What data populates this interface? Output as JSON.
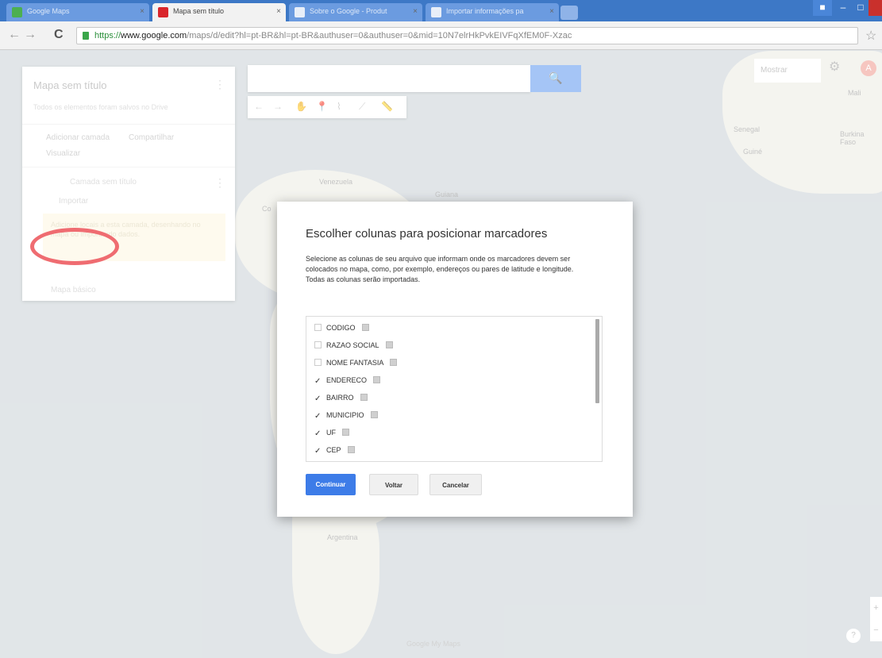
{
  "browser": {
    "tabs": [
      {
        "label": "Google Maps",
        "active": false
      },
      {
        "label": "Mapa sem título",
        "active": true
      },
      {
        "label": "Sobre o Google - Produt",
        "active": false
      },
      {
        "label": "Importar informações pa",
        "active": false
      }
    ],
    "close_glyph": "×",
    "url_scheme": "https://",
    "url_host": "www.google.com",
    "url_path": "/maps/d/edit?hl=pt-BR&hl=pt-BR&authuser=0&authuser=0&mid=10N7elrHkPvkEIVFqXfEM0F-Xzac",
    "back_glyph": "←",
    "forward_glyph": "→",
    "reload_glyph": "C",
    "star_glyph": "☆",
    "minimize_glyph": "–",
    "maximize_glyph": "□"
  },
  "left_panel": {
    "title": "Mapa sem título",
    "description": "Todos os elementos foram salvos no Drive",
    "add_layer": "Adicionar camada",
    "share": "Compartilhar",
    "preview": "Visualizar",
    "layer_name": "Camada sem título",
    "import": "Importar",
    "note": "Adicione locais a esta camada, desenhando no mapa ou importando dados.",
    "base_map": "Mapa básico",
    "menu_glyph": "⋮"
  },
  "map": {
    "search_icon": "🔍",
    "tools": [
      "←",
      "→",
      "✋",
      "📍",
      "⌇",
      "⟋",
      "📏"
    ],
    "top_right_label": "Mostrar",
    "gear_glyph": "⚙",
    "avatar_letter": "A",
    "labels": {
      "mali": "Mali",
      "venezuela": "Venezuela",
      "guiana": "Guiana",
      "colombia": "Co",
      "argentina": "Argentina",
      "senegal": "Senegal",
      "guinea": "Guiné",
      "burkina": "Burkina Faso"
    },
    "zoom_in": "+",
    "zoom_out": "−",
    "help": "?",
    "footer": "Google My Maps"
  },
  "dialog": {
    "title": "Escolher colunas para posicionar marcadores",
    "description": "Selecione as colunas de seu arquivo que informam onde os marcadores devem ser colocados no mapa, como, por exemplo, endereços ou pares de latitude e longitude. Todas as colunas serão importadas.",
    "columns": [
      {
        "name": "CODIGO",
        "checked": false
      },
      {
        "name": "RAZAO SOCIAL",
        "checked": false
      },
      {
        "name": "NOME FANTASIA",
        "checked": false
      },
      {
        "name": "ENDERECO",
        "checked": true
      },
      {
        "name": "BAIRRO",
        "checked": true
      },
      {
        "name": "MUNICIPIO",
        "checked": true
      },
      {
        "name": "UF",
        "checked": true
      },
      {
        "name": "CEP",
        "checked": true
      }
    ],
    "check_glyph": "✓",
    "buttons": {
      "continue": "Continuar",
      "back": "Voltar",
      "cancel": "Cancelar"
    }
  },
  "colors": {
    "tabbar": "#3d78c6",
    "primary_button": "#3d7ce8",
    "annotation_red": "#e5121a",
    "map_water": "#cfd6da",
    "map_land": "#eeeee6"
  }
}
